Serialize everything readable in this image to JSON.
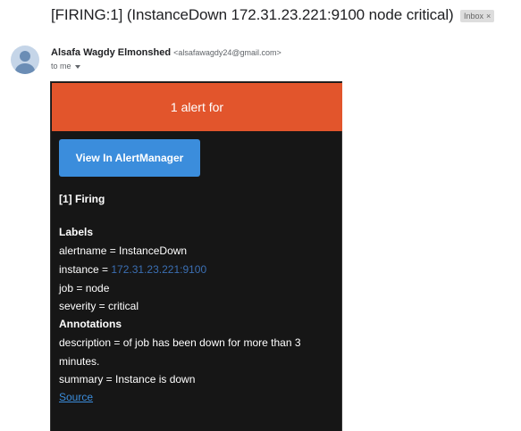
{
  "email": {
    "subject": "[FIRING:1] (InstanceDown 172.31.23.221:9100 node critical)",
    "label_chip": "Inbox",
    "label_chip_close": "×",
    "sender_name": "Alsafa Wagdy Elmonshed",
    "sender_email": "<alsafawagdy24@gmail.com>",
    "recipient": "to me"
  },
  "alert": {
    "banner": "1 alert for",
    "button": "View In AlertManager",
    "firing_heading": "[1] Firing",
    "labels_heading": "Labels",
    "alertname": "alertname = InstanceDown",
    "instance_label": "instance = ",
    "instance_value": "172.31.23.221:9100",
    "job": "job = node",
    "severity": "severity = critical",
    "annotations_heading": "Annotations",
    "description_line1": "description = of job has been down for more than 3",
    "description_line2": "minutes.",
    "summary": "summary = Instance is down",
    "source_link": "Source"
  },
  "colors": {
    "banner": "#e2552c",
    "button": "#3b8ddc",
    "card_bg": "#161616",
    "link": "#3b8ddc"
  }
}
